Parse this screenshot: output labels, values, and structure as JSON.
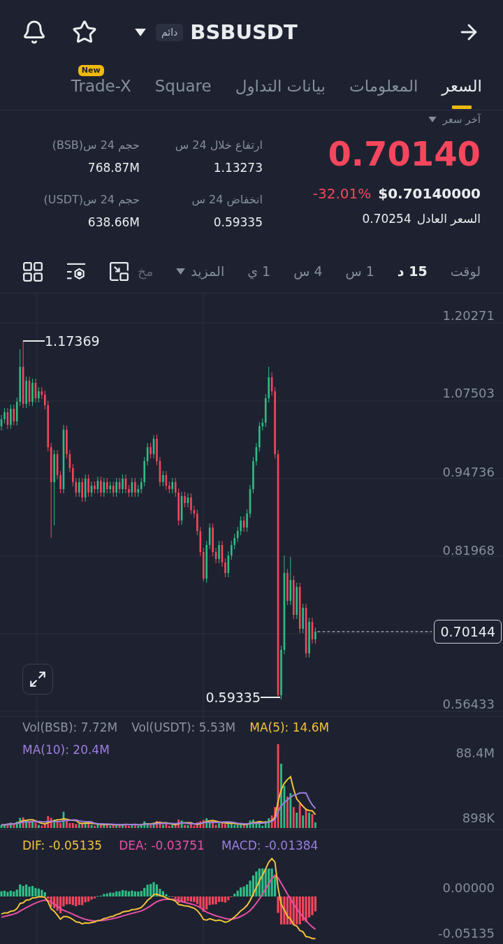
{
  "header": {
    "contract_badge": "دائم",
    "symbol": "BSBUSDT"
  },
  "tabs": [
    {
      "label": "السعر",
      "selected": true
    },
    {
      "label": "المعلومات",
      "selected": false
    },
    {
      "label": "بيانات التداول",
      "selected": false
    },
    {
      "label": "Square",
      "selected": false
    },
    {
      "label": "Trade-X",
      "selected": false,
      "badge": "New"
    }
  ],
  "price_panel": {
    "price_type": "آخر سعر",
    "last_price": "0.70140",
    "falling": true,
    "usd_price": "$0.70140000",
    "change": "-32.01%",
    "fair_price_label": "السعر العادل",
    "fair_price": "0.70254"
  },
  "stat_columns": [
    [
      {
        "label": "ارتفاع خلال 24 س",
        "value": "1.13273"
      },
      {
        "label": "انخفاض 24 س",
        "value": "0.59335"
      }
    ],
    [
      {
        "label": "حجم 24 س(BSB)",
        "value": "768.87M"
      },
      {
        "label": "حجم 24 س(USDT)",
        "value": "638.66M"
      }
    ]
  ],
  "intervals": [
    {
      "label": "لوقت",
      "selected": false
    },
    {
      "label": "15 د",
      "selected": true
    },
    {
      "label": "1 س",
      "selected": false
    },
    {
      "label": "4 س",
      "selected": false
    },
    {
      "label": "1 ي",
      "selected": false
    }
  ],
  "more_menu": {
    "label": "المزيد"
  },
  "partial_label": "مخ",
  "price_chart": {
    "axis_labels": [
      "1.20271",
      "1.07503",
      "0.94736",
      "0.81968",
      "0.56433"
    ],
    "high_marker": "1.17369",
    "low_marker": "0.59335",
    "current_price": "0.70144"
  },
  "volume_panel": {
    "vol_bsb": {
      "text": "Vol(BSB): 7.72M",
      "color": "#8b93a2"
    },
    "vol_usdt": {
      "text": "Vol(USDT): 5.53M",
      "color": "#8b93a2"
    },
    "ma_5": {
      "text": "MA(5): 14.6M",
      "color": "#f0c33c"
    },
    "ma_10": {
      "text": "MA(10): 20.4M",
      "color": "#9c7ee0"
    },
    "axis_labels": [
      "88.4M",
      "898K"
    ]
  },
  "macd_panel": {
    "dif": {
      "text": "DIF: -0.05135",
      "color": "#f0c33c"
    },
    "dea": {
      "text": "DEA: -0.03751",
      "color": "#e84fa6"
    },
    "macd": {
      "text": "MACD: -0.01384",
      "color": "#9c7ee0"
    },
    "axis_labels": [
      "0.00000",
      "-0.05135"
    ]
  }
}
